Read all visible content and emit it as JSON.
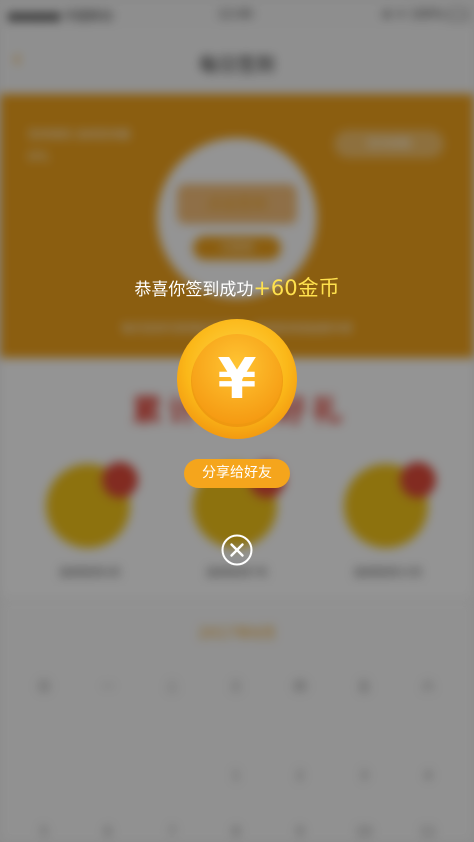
{
  "background_app": {
    "statusbar": {
      "carrier": "●●●●● 中国移动",
      "time": "12:00",
      "right": "⊕ ✈ 100%"
    },
    "navbar": {
      "back_icon": "chevron-left-icon",
      "title": "每日签到"
    },
    "banner": {
      "rule_text": "签到规则 连续签到赢好礼",
      "remind_label": "签到提醒",
      "circle_main": "点击签到",
      "circle_sub": "已签到",
      "desc": "每天签到可获得金币奖励，连续签到奖励更丰厚"
    },
    "prize_section": {
      "heading": "累计签到好礼",
      "items": [
        {
          "caption": "连续签到3天"
        },
        {
          "caption": "连续签到7天"
        },
        {
          "caption": "连续签到15天"
        }
      ]
    },
    "calendar": {
      "title": "2017年6月",
      "days": [
        "日",
        "一",
        "二",
        "三",
        "四",
        "五",
        "六",
        "",
        "",
        "",
        "1",
        "2",
        "3",
        "4",
        "5",
        "6",
        "7",
        "8",
        "9",
        "10",
        "11"
      ]
    }
  },
  "modal": {
    "message_prefix": "恭喜你签到成功",
    "reward_text": "+60金币",
    "coin_symbol": "¥",
    "share_label": "分享给好友",
    "close_icon": "close-circle-icon"
  },
  "colors": {
    "coin_gold": "#f8b51a",
    "reward_yellow": "#ffe14d",
    "share_orange": "#f5a51c",
    "banner_orange": "#f0a21c"
  }
}
